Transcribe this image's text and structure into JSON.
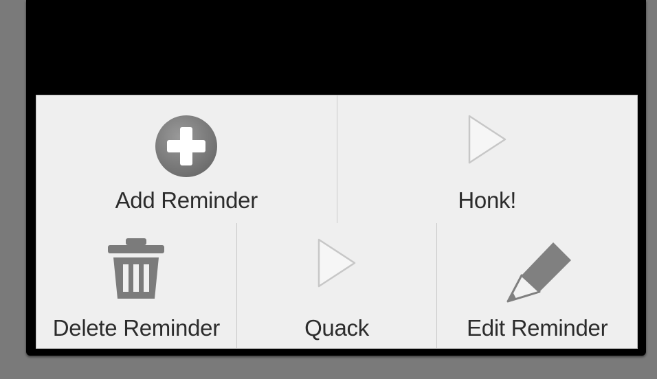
{
  "options_menu": {
    "items": [
      {
        "label": "Add Reminder",
        "icon": "plus-circle-icon"
      },
      {
        "label": "Honk!",
        "icon": "play-icon"
      },
      {
        "label": "Delete Reminder",
        "icon": "trash-icon"
      },
      {
        "label": "Quack",
        "icon": "play-icon"
      },
      {
        "label": "Edit Reminder",
        "icon": "pencil-icon"
      }
    ]
  },
  "colors": {
    "screen_background": "#000000",
    "menu_background": "#efefef",
    "icon_gray": "#7d7d7d",
    "play_icon_fill": "#f4f4f4",
    "label_text": "#2c2c2c"
  }
}
